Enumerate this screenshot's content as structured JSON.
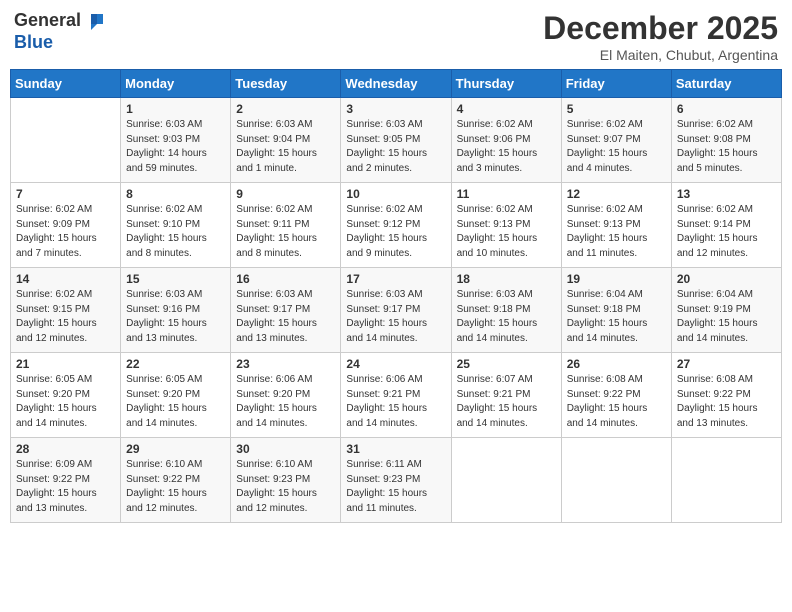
{
  "header": {
    "logo_general": "General",
    "logo_blue": "Blue",
    "month_title": "December 2025",
    "location": "El Maiten, Chubut, Argentina"
  },
  "days_of_week": [
    "Sunday",
    "Monday",
    "Tuesday",
    "Wednesday",
    "Thursday",
    "Friday",
    "Saturday"
  ],
  "weeks": [
    [
      {
        "day": null,
        "content": ""
      },
      {
        "day": "1",
        "content": "Sunrise: 6:03 AM\nSunset: 9:03 PM\nDaylight: 14 hours\nand 59 minutes."
      },
      {
        "day": "2",
        "content": "Sunrise: 6:03 AM\nSunset: 9:04 PM\nDaylight: 15 hours\nand 1 minute."
      },
      {
        "day": "3",
        "content": "Sunrise: 6:03 AM\nSunset: 9:05 PM\nDaylight: 15 hours\nand 2 minutes."
      },
      {
        "day": "4",
        "content": "Sunrise: 6:02 AM\nSunset: 9:06 PM\nDaylight: 15 hours\nand 3 minutes."
      },
      {
        "day": "5",
        "content": "Sunrise: 6:02 AM\nSunset: 9:07 PM\nDaylight: 15 hours\nand 4 minutes."
      },
      {
        "day": "6",
        "content": "Sunrise: 6:02 AM\nSunset: 9:08 PM\nDaylight: 15 hours\nand 5 minutes."
      }
    ],
    [
      {
        "day": "7",
        "content": "Sunrise: 6:02 AM\nSunset: 9:09 PM\nDaylight: 15 hours\nand 7 minutes."
      },
      {
        "day": "8",
        "content": "Sunrise: 6:02 AM\nSunset: 9:10 PM\nDaylight: 15 hours\nand 8 minutes."
      },
      {
        "day": "9",
        "content": "Sunrise: 6:02 AM\nSunset: 9:11 PM\nDaylight: 15 hours\nand 8 minutes."
      },
      {
        "day": "10",
        "content": "Sunrise: 6:02 AM\nSunset: 9:12 PM\nDaylight: 15 hours\nand 9 minutes."
      },
      {
        "day": "11",
        "content": "Sunrise: 6:02 AM\nSunset: 9:13 PM\nDaylight: 15 hours\nand 10 minutes."
      },
      {
        "day": "12",
        "content": "Sunrise: 6:02 AM\nSunset: 9:13 PM\nDaylight: 15 hours\nand 11 minutes."
      },
      {
        "day": "13",
        "content": "Sunrise: 6:02 AM\nSunset: 9:14 PM\nDaylight: 15 hours\nand 12 minutes."
      }
    ],
    [
      {
        "day": "14",
        "content": "Sunrise: 6:02 AM\nSunset: 9:15 PM\nDaylight: 15 hours\nand 12 minutes."
      },
      {
        "day": "15",
        "content": "Sunrise: 6:03 AM\nSunset: 9:16 PM\nDaylight: 15 hours\nand 13 minutes."
      },
      {
        "day": "16",
        "content": "Sunrise: 6:03 AM\nSunset: 9:17 PM\nDaylight: 15 hours\nand 13 minutes."
      },
      {
        "day": "17",
        "content": "Sunrise: 6:03 AM\nSunset: 9:17 PM\nDaylight: 15 hours\nand 14 minutes."
      },
      {
        "day": "18",
        "content": "Sunrise: 6:03 AM\nSunset: 9:18 PM\nDaylight: 15 hours\nand 14 minutes."
      },
      {
        "day": "19",
        "content": "Sunrise: 6:04 AM\nSunset: 9:18 PM\nDaylight: 15 hours\nand 14 minutes."
      },
      {
        "day": "20",
        "content": "Sunrise: 6:04 AM\nSunset: 9:19 PM\nDaylight: 15 hours\nand 14 minutes."
      }
    ],
    [
      {
        "day": "21",
        "content": "Sunrise: 6:05 AM\nSunset: 9:20 PM\nDaylight: 15 hours\nand 14 minutes."
      },
      {
        "day": "22",
        "content": "Sunrise: 6:05 AM\nSunset: 9:20 PM\nDaylight: 15 hours\nand 14 minutes."
      },
      {
        "day": "23",
        "content": "Sunrise: 6:06 AM\nSunset: 9:20 PM\nDaylight: 15 hours\nand 14 minutes."
      },
      {
        "day": "24",
        "content": "Sunrise: 6:06 AM\nSunset: 9:21 PM\nDaylight: 15 hours\nand 14 minutes."
      },
      {
        "day": "25",
        "content": "Sunrise: 6:07 AM\nSunset: 9:21 PM\nDaylight: 15 hours\nand 14 minutes."
      },
      {
        "day": "26",
        "content": "Sunrise: 6:08 AM\nSunset: 9:22 PM\nDaylight: 15 hours\nand 14 minutes."
      },
      {
        "day": "27",
        "content": "Sunrise: 6:08 AM\nSunset: 9:22 PM\nDaylight: 15 hours\nand 13 minutes."
      }
    ],
    [
      {
        "day": "28",
        "content": "Sunrise: 6:09 AM\nSunset: 9:22 PM\nDaylight: 15 hours\nand 13 minutes."
      },
      {
        "day": "29",
        "content": "Sunrise: 6:10 AM\nSunset: 9:22 PM\nDaylight: 15 hours\nand 12 minutes."
      },
      {
        "day": "30",
        "content": "Sunrise: 6:10 AM\nSunset: 9:23 PM\nDaylight: 15 hours\nand 12 minutes."
      },
      {
        "day": "31",
        "content": "Sunrise: 6:11 AM\nSunset: 9:23 PM\nDaylight: 15 hours\nand 11 minutes."
      },
      {
        "day": null,
        "content": ""
      },
      {
        "day": null,
        "content": ""
      },
      {
        "day": null,
        "content": ""
      }
    ]
  ]
}
